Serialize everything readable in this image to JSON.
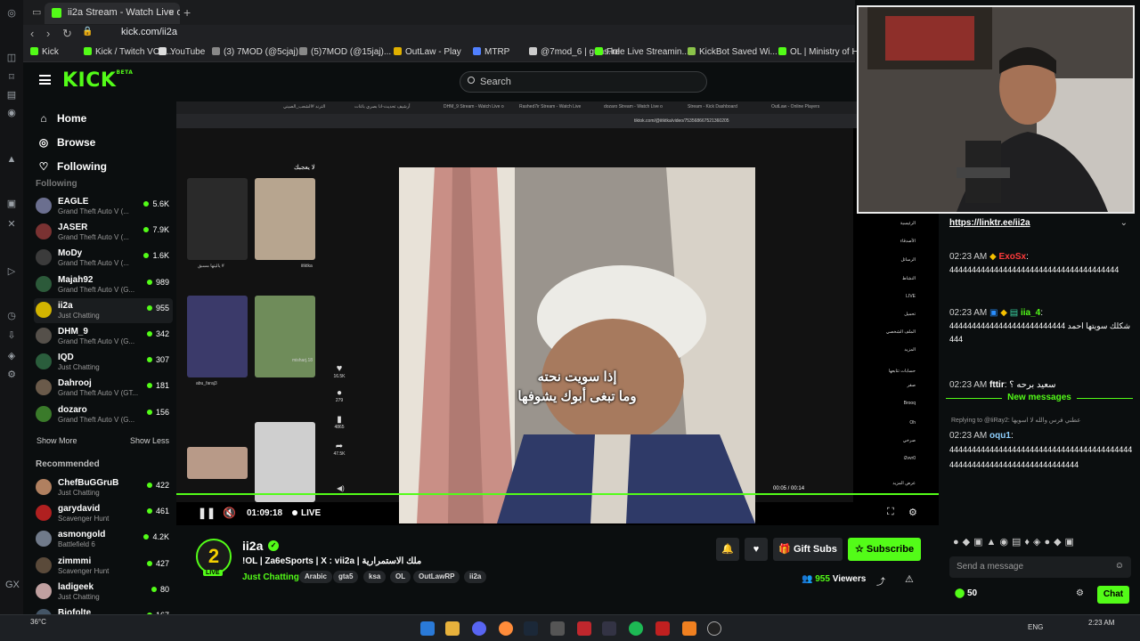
{
  "browser": {
    "tab_title": "ii2a Stream - Watch Live o",
    "url": "kick.com/ii2a",
    "bookmarks": [
      "Kick",
      "Kick / Twitch VOD...",
      "YouTube",
      "(3) 7MOD (@5cjaj)...",
      "(5)7MOD (@15jaj)...",
      "OutLaw - Play",
      "MTRP",
      "@7mod_6 | guns.lol",
      "Free Live Streamin...",
      "KickBot Saved Wi...",
      "OL | Ministry of H..."
    ]
  },
  "header": {
    "logo": "KICK",
    "logo_sup": "BETA",
    "search_placeholder": "Search"
  },
  "sidebar": {
    "nav": [
      {
        "label": "Home",
        "icon": "home-icon"
      },
      {
        "label": "Browse",
        "icon": "compass-icon"
      },
      {
        "label": "Following",
        "icon": "heart-icon"
      }
    ],
    "following_header": "Following",
    "following": [
      {
        "name": "EAGLE",
        "category": "Grand Theft Auto V (...",
        "viewers": "5.6K",
        "color": "#6b6f8f"
      },
      {
        "name": "JASER",
        "category": "Grand Theft Auto V (...",
        "viewers": "7.9K",
        "color": "#7a3232"
      },
      {
        "name": "MoDy",
        "category": "Grand Theft Auto V (...",
        "viewers": "1.6K",
        "color": "#3b3b3b"
      },
      {
        "name": "Majah92",
        "category": "Grand Theft Auto V (G...",
        "viewers": "989",
        "color": "#2c5a3a"
      },
      {
        "name": "ii2a",
        "category": "Just Chatting",
        "viewers": "955",
        "color": "#d2b400"
      },
      {
        "name": "DHM_9",
        "category": "Grand Theft Auto V (G...",
        "viewers": "342",
        "color": "#55504a"
      },
      {
        "name": "IQD",
        "category": "Just Chatting",
        "viewers": "307",
        "color": "#2a5d3c"
      },
      {
        "name": "Dahrooj",
        "category": "Grand Theft Auto V (GT...",
        "viewers": "181",
        "color": "#6a5a4a"
      },
      {
        "name": "dozaro",
        "category": "Grand Theft Auto V (G...",
        "viewers": "156",
        "color": "#3a7a2a"
      }
    ],
    "show_more": "Show More",
    "show_less": "Show Less",
    "recommended_header": "Recommended",
    "recommended": [
      {
        "name": "ChefBuGGruB",
        "category": "Just Chatting",
        "viewers": "422",
        "color": "#b08060"
      },
      {
        "name": "garydavid",
        "category": "Scavenger Hunt",
        "viewers": "461",
        "color": "#b02020"
      },
      {
        "name": "asmongold",
        "category": "Battlefield 6",
        "viewers": "4.2K",
        "color": "#707a8a"
      },
      {
        "name": "zimmmi",
        "category": "Scavenger Hunt",
        "viewers": "427",
        "color": "#5a4a3a"
      },
      {
        "name": "ladigeek",
        "category": "Just Chatting",
        "viewers": "80",
        "color": "#c0a0a0"
      },
      {
        "name": "Biofolte",
        "category": "",
        "viewers": "167",
        "color": "#445566"
      }
    ]
  },
  "video": {
    "overlay_line1": "إذا سويت نحته",
    "overlay_line2": "وما تبغى أبوك يشوفها",
    "tiktok_url": "tiktok.com/@iitktka/video/753568667521360205",
    "time": "01:09:18",
    "live_label": "LIVE",
    "tiktok_time": "00:05 / 00:14",
    "likes": "16.5K",
    "comments": "279",
    "saves": "4865",
    "shares": "47.5K",
    "side_menu": [
      "الرئيسية",
      "الأصدقاء",
      "الرسائل",
      "النشاط",
      "LIVE",
      "تحميل",
      "الملف الشخصي",
      "المزيد",
      "حسابات تتابعها",
      "صقر",
      "Brooq",
      "Oh",
      "صرخي",
      "i2vvr0",
      "عرض المزيد"
    ]
  },
  "chat": {
    "link": "https://linktr.ee/ii2a",
    "messages": [
      {
        "time": "02:23 AM",
        "user": "ExoSx",
        "color": "#ff3b3b",
        "text": "44444444444444444444444444444444444444"
      },
      {
        "time": "02:23 AM",
        "user": "iia_4",
        "color": "#53fc18",
        "text": "شكلك سويتها احمد 44444444444444444444444444444"
      },
      {
        "time": "02:23 AM",
        "user": "fttir",
        "color": "#ffffff",
        "text": "سعيد برحه ؟"
      },
      {
        "time": "02:23 AM",
        "user": "oqu1",
        "color": "#8fd0ff",
        "text": "4444444444444444444444444444444444444444444444444444444444444444444444"
      }
    ],
    "new_messages": "New messages",
    "replying": "Replying to @IiRay2: عطني فرس والله لا اسويها",
    "input_placeholder": "Send a message",
    "points": "50",
    "chat_button": "Chat"
  },
  "stream": {
    "name": "ii2a",
    "title": "!OL | Za6eSports | X : vii2a | ملك الاستمرارية",
    "category": "Just Chatting",
    "tags": [
      "Arabic",
      "gta5",
      "ksa",
      "OL",
      "OutLawRP",
      "ii2a"
    ],
    "gift_subs": "Gift Subs",
    "subscribe": "Subscribe",
    "viewers": "955",
    "viewers_label": "Viewers",
    "live_badge": "LIVE"
  },
  "taskbar": {
    "lang": "ENG",
    "clock": "2:23 AM",
    "weather": "36°C"
  }
}
